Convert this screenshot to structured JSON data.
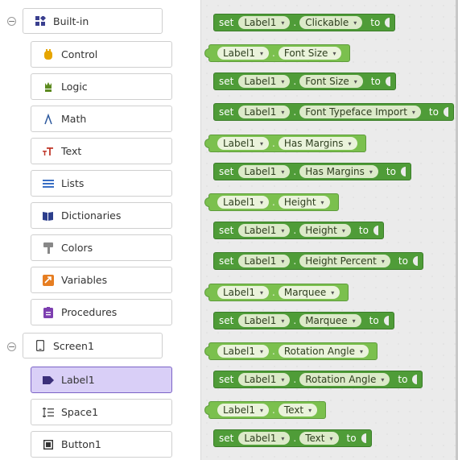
{
  "sidebar": {
    "builtin": {
      "label": "Built-in",
      "toggle": "−",
      "items": [
        {
          "label": "Control",
          "icon": "control-icon",
          "color": "#e6a500"
        },
        {
          "label": "Logic",
          "icon": "logic-icon",
          "color": "#5c8a1f"
        },
        {
          "label": "Math",
          "icon": "math-icon",
          "color": "#2e5a9e"
        },
        {
          "label": "Text",
          "icon": "text-icon",
          "color": "#c0392b"
        },
        {
          "label": "Lists",
          "icon": "lists-icon",
          "color": "#3a6fc4"
        },
        {
          "label": "Dictionaries",
          "icon": "dictionaries-icon",
          "color": "#2c3e8c"
        },
        {
          "label": "Colors",
          "icon": "colors-icon",
          "color": "#888888"
        },
        {
          "label": "Variables",
          "icon": "variables-icon",
          "color": "#e67e22"
        },
        {
          "label": "Procedures",
          "icon": "procedures-icon",
          "color": "#7d3fb0"
        }
      ]
    },
    "screen": {
      "label": "Screen1",
      "toggle": "−",
      "items": [
        {
          "label": "Label1",
          "icon": "label-icon",
          "selected": true
        },
        {
          "label": "Space1",
          "icon": "space-icon",
          "selected": false
        },
        {
          "label": "Button1",
          "icon": "button-icon",
          "selected": false
        }
      ]
    }
  },
  "workspace": {
    "blocks": [
      {
        "type": "setter",
        "kw": "set",
        "component": "Label1",
        "property": "Clickable",
        "to": "to"
      },
      {
        "type": "getter",
        "component": "Label1",
        "property": "Font Size"
      },
      {
        "type": "setter",
        "kw": "set",
        "component": "Label1",
        "property": "Font Size",
        "to": "to"
      },
      {
        "type": "setter",
        "kw": "set",
        "component": "Label1",
        "property": "Font Typeface Import",
        "to": "to"
      },
      {
        "type": "getter",
        "component": "Label1",
        "property": "Has Margins"
      },
      {
        "type": "setter",
        "kw": "set",
        "component": "Label1",
        "property": "Has Margins",
        "to": "to"
      },
      {
        "type": "getter",
        "component": "Label1",
        "property": "Height"
      },
      {
        "type": "setter",
        "kw": "set",
        "component": "Label1",
        "property": "Height",
        "to": "to"
      },
      {
        "type": "setter",
        "kw": "set",
        "component": "Label1",
        "property": "Height Percent",
        "to": "to"
      },
      {
        "type": "getter",
        "component": "Label1",
        "property": "Marquee"
      },
      {
        "type": "setter",
        "kw": "set",
        "component": "Label1",
        "property": "Marquee",
        "to": "to"
      },
      {
        "type": "getter",
        "component": "Label1",
        "property": "Rotation Angle"
      },
      {
        "type": "setter",
        "kw": "set",
        "component": "Label1",
        "property": "Rotation Angle",
        "to": "to"
      },
      {
        "type": "getter",
        "component": "Label1",
        "property": "Text"
      },
      {
        "type": "setter",
        "kw": "set",
        "component": "Label1",
        "property": "Text",
        "to": "to"
      }
    ],
    "dropdown_glyph": "▾",
    "dot": "."
  }
}
